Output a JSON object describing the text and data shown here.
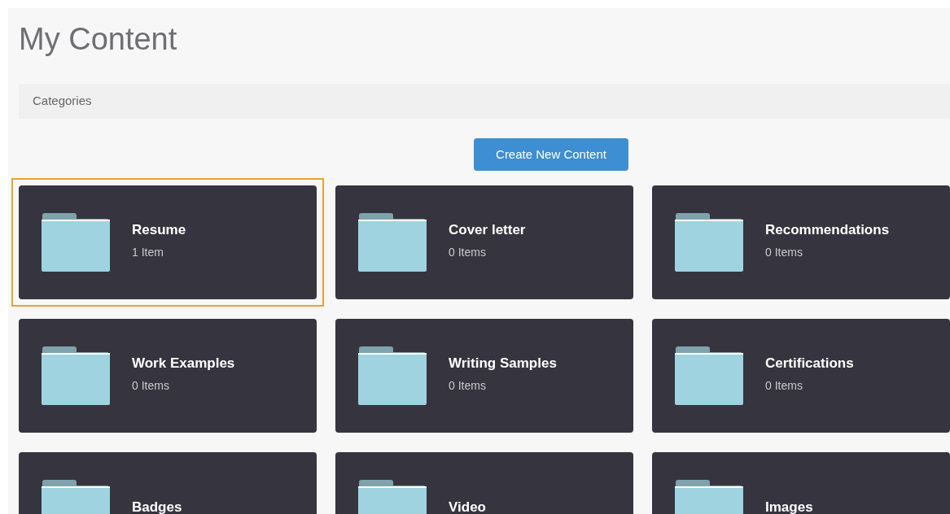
{
  "title": "My Content",
  "categories_bar": {
    "label": "Categories"
  },
  "create_button": "Create New Content",
  "folders": [
    {
      "name": "Resume",
      "count": "1 Item",
      "selected": true
    },
    {
      "name": "Cover letter",
      "count": "0 Items",
      "selected": false
    },
    {
      "name": "Recommendations",
      "count": "0 Items",
      "selected": false
    },
    {
      "name": "Work Examples",
      "count": "0 Items",
      "selected": false
    },
    {
      "name": "Writing Samples",
      "count": "0 Items",
      "selected": false
    },
    {
      "name": "Certifications",
      "count": "0 Items",
      "selected": false
    },
    {
      "name": "Badges",
      "selected": false
    },
    {
      "name": "Video",
      "selected": false
    },
    {
      "name": "Images",
      "selected": false
    }
  ]
}
